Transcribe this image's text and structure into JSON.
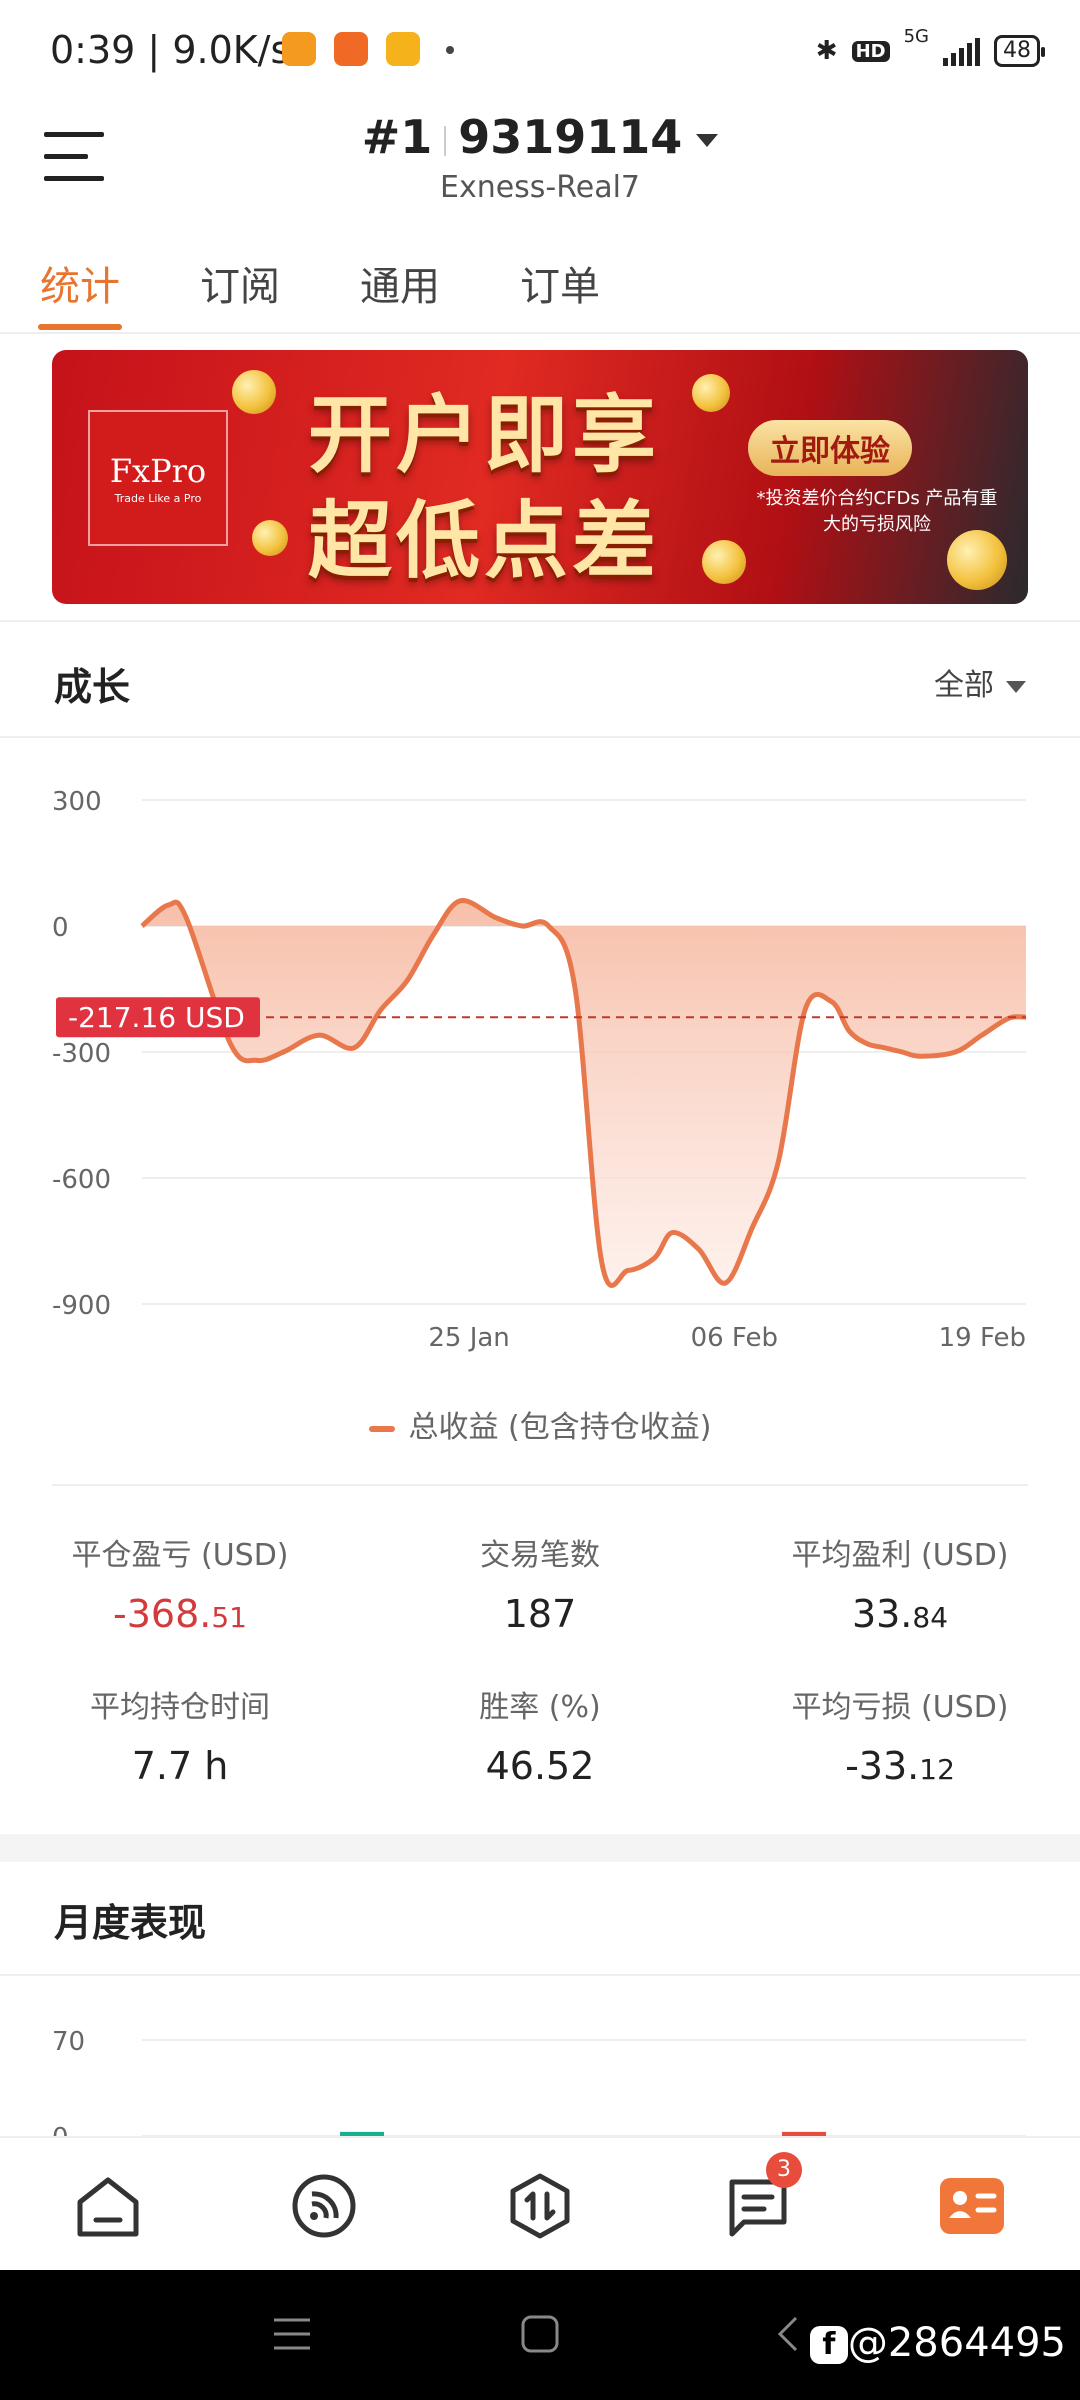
{
  "status_bar": {
    "time": "0:39",
    "net_speed": "9.0K/s",
    "network": "5G",
    "hd_badge": "HD",
    "battery": "48"
  },
  "header": {
    "account_prefix": "#1",
    "account_number": "9319114",
    "server": "Exness-Real7"
  },
  "tabs": [
    {
      "label": "统计",
      "active": true
    },
    {
      "label": "订阅",
      "active": false
    },
    {
      "label": "通用",
      "active": false
    },
    {
      "label": "订单",
      "active": false
    }
  ],
  "banner": {
    "brand": "FxPro",
    "brand_tagline": "Trade Like a Pro",
    "line1": "开户即享",
    "line2": "超低点差",
    "cta": "立即体验",
    "warning": "*投资差价合约CFDs 产品有重大的亏损风险"
  },
  "growth": {
    "title": "成长",
    "filter": "全部",
    "current_value_label": "-217.16 USD",
    "legend": "总收益 (包含持仓收益)"
  },
  "chart_data": [
    {
      "type": "area",
      "title": "成长",
      "ylim": [
        -900,
        300
      ],
      "y_ticks": [
        "300",
        "0",
        "-300",
        "-600",
        "-900"
      ],
      "x_ticks": [
        "25 Jan",
        "06 Feb",
        "19 Feb"
      ],
      "reference_line": -217.16,
      "series": [
        {
          "name": "总收益 (包含持仓收益)",
          "color": "#e8784b",
          "x": [
            0,
            0.03,
            0.05,
            0.1,
            0.13,
            0.16,
            0.2,
            0.24,
            0.27,
            0.3,
            0.33,
            0.36,
            0.4,
            0.43,
            0.46,
            0.49,
            0.52,
            0.55,
            0.58,
            0.6,
            0.63,
            0.66,
            0.69,
            0.72,
            0.75,
            0.78,
            0.8,
            0.82,
            0.84,
            0.86,
            0.88,
            0.92,
            0.95,
            0.98,
            1.0
          ],
          "values": [
            0,
            50,
            20,
            -280,
            -320,
            -300,
            -260,
            -290,
            -200,
            -130,
            -20,
            60,
            20,
            0,
            0,
            -150,
            -800,
            -820,
            -790,
            -730,
            -770,
            -850,
            -720,
            -560,
            -200,
            -180,
            -250,
            -280,
            -290,
            -300,
            -310,
            -300,
            -260,
            -220,
            -217
          ]
        }
      ]
    },
    {
      "type": "bar",
      "title": "月度表现",
      "ylim": [
        0,
        70
      ],
      "y_ticks": [
        "70",
        "0"
      ],
      "series": [
        {
          "name": "",
          "color": "#1aaf8f",
          "values": [
            3
          ]
        },
        {
          "name": "",
          "color": "#e84c3d",
          "values": [
            -3
          ]
        }
      ]
    }
  ],
  "stats": [
    {
      "label": "平仓盈亏 (USD)",
      "int": "-368.",
      "dec": "51",
      "negative": true
    },
    {
      "label": "交易笔数",
      "int": "187",
      "dec": "",
      "negative": false
    },
    {
      "label": "平均盈利 (USD)",
      "int": "33.",
      "dec": "84",
      "negative": false
    },
    {
      "label": "平均持仓时间",
      "int": "7.7 h",
      "dec": "",
      "negative": false
    },
    {
      "label": "胜率 (%)",
      "int": "46.52",
      "dec": "",
      "negative": false
    },
    {
      "label": "平均亏损 (USD)",
      "int": "-33.",
      "dec": "12",
      "negative": false
    }
  ],
  "monthly": {
    "title": "月度表现"
  },
  "bottom_nav": {
    "items": [
      "home-icon",
      "signal-feed-icon",
      "trade-icon",
      "messages-icon",
      "profile-card-icon"
    ],
    "messages_badge": "3"
  },
  "watermark": "@2864495"
}
